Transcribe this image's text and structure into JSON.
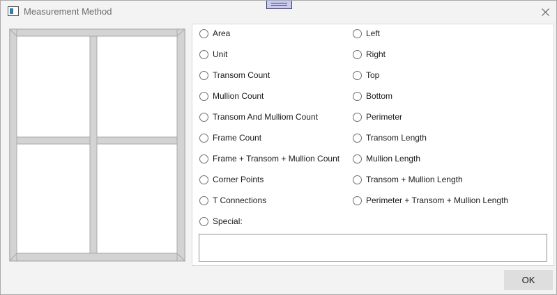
{
  "window": {
    "title": "Measurement Method",
    "icon": "window-app-icon",
    "close_icon": "close-icon"
  },
  "options": {
    "left_column": [
      {
        "label": "Area",
        "selected": false
      },
      {
        "label": "Unit",
        "selected": false
      },
      {
        "label": "Transom Count",
        "selected": false
      },
      {
        "label": "Mullion Count",
        "selected": false
      },
      {
        "label": "Transom And Mulliom Count",
        "selected": false
      },
      {
        "label": "Frame Count",
        "selected": false
      },
      {
        "label": "Frame + Transom + Mullion Count",
        "selected": false
      },
      {
        "label": "Corner Points",
        "selected": false
      },
      {
        "label": "T Connections",
        "selected": false
      },
      {
        "label": "Special:",
        "selected": false
      }
    ],
    "right_column": [
      {
        "label": "Left",
        "selected": false
      },
      {
        "label": "Right",
        "selected": false
      },
      {
        "label": "Top",
        "selected": false
      },
      {
        "label": "Bottom",
        "selected": false
      },
      {
        "label": "Perimeter",
        "selected": false
      },
      {
        "label": "Transom Length",
        "selected": false
      },
      {
        "label": "Mullion Length",
        "selected": false
      },
      {
        "label": "Transom + Mullion Length",
        "selected": false
      },
      {
        "label": "Perimeter + Transom + Mullion Length",
        "selected": false
      }
    ],
    "special_value": ""
  },
  "footer": {
    "ok_label": "OK"
  },
  "colors": {
    "frame_fill": "#d3d3d3",
    "frame_stroke": "#a8a8a8"
  }
}
